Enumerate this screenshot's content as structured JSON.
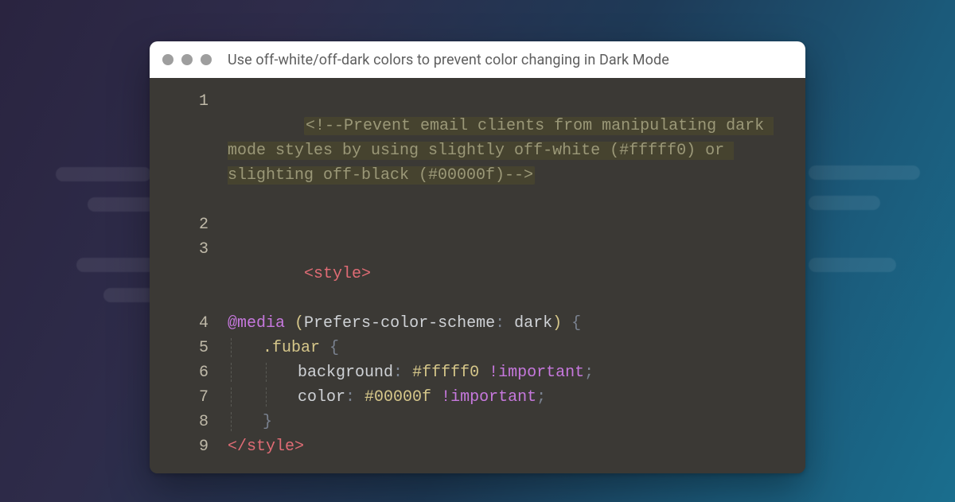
{
  "window": {
    "title": "Use off-white/off-dark colors to prevent color changing in Dark Mode"
  },
  "code": {
    "comment": "<!--Prevent email clients from manipulating dark mode styles by using slightly off-white (#fffff0) or slighting off-black (#00000f)-->",
    "style_open": "<style>",
    "style_close": "</style>",
    "at_media": "@media",
    "media_query_prop": "Prefers-color-scheme",
    "media_query_val": "dark",
    "selector": ".fubar",
    "rule1_prop": "background",
    "rule1_val": "#fffff0",
    "rule1_imp": "!important",
    "rule2_prop": "color",
    "rule2_val": "#00000f",
    "rule2_imp": "!important",
    "brace_open": "{",
    "brace_close": "}",
    "paren_open": "(",
    "paren_close": ")",
    "colon": ":",
    "semi": ";",
    "space": " "
  },
  "line_numbers": [
    "1",
    "2",
    "3",
    "4",
    "5",
    "6",
    "7",
    "8",
    "9"
  ]
}
